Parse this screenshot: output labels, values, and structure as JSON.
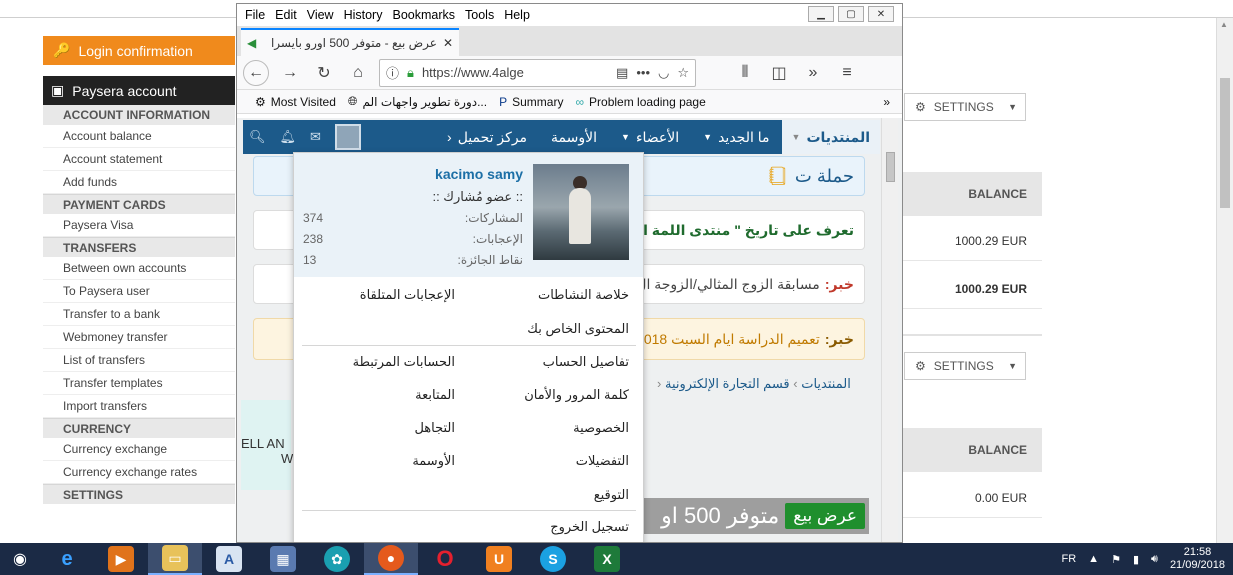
{
  "paysera": {
    "login_btn": "Login confirmation",
    "account_head": "Paysera account",
    "sections": [
      {
        "title": "ACCOUNT INFORMATION",
        "links": [
          "Account balance",
          "Account statement",
          "Add funds"
        ]
      },
      {
        "title": "PAYMENT CARDS",
        "links": [
          "Paysera Visa"
        ]
      },
      {
        "title": "TRANSFERS",
        "links": [
          "Between own accounts",
          "To Paysera user",
          "Transfer to a bank",
          "Webmoney transfer",
          "List of transfers",
          "Transfer templates",
          "Import transfers"
        ]
      },
      {
        "title": "CURRENCY",
        "links": [
          "Currency exchange",
          "Currency exchange rates"
        ]
      },
      {
        "title": "SETTINGS",
        "links": []
      }
    ],
    "settings_label": "SETTINGS",
    "balance_label": "BALANCE",
    "balances": [
      "1000.29 EUR",
      "1000.29 EUR",
      "0.00 EUR"
    ]
  },
  "firefox": {
    "menus": [
      "File",
      "Edit",
      "View",
      "History",
      "Bookmarks",
      "Tools",
      "Help"
    ],
    "tab_title": "عرض بيع - متوفر 500 اورو بايسرا",
    "url": "https://www.4alge",
    "bookmarks": [
      "Most Visited",
      "دورة تطوير واجهات الم...",
      "Summary",
      "Problem loading page"
    ]
  },
  "forum": {
    "nav": [
      "المنتديات",
      "ما الجديد",
      "الأعضاء",
      "الأوسمة",
      "مركز تحميل"
    ],
    "cards": [
      {
        "text": "حملة ت"
      },
      {
        "text": "تعرف على تاريخ \" منتدى اللمة ال"
      },
      {
        "tag": "خبر:",
        "text": "مسابقة الزوج المثالي/الزوجة ال"
      },
      {
        "tag": "خبر:",
        "text": "تعميم الدراسة ايام السبت 2018"
      }
    ],
    "breadcrumb": [
      "المنتديات",
      "قسم التجارة الإلكترونية"
    ],
    "left_text": [
      "ELL AN",
      "W"
    ],
    "sale_btn": "عرض بيع",
    "sale_text": "متوفر 500 او"
  },
  "user_menu": {
    "name": "kacimo samy",
    "rank": ":: عضو مُشارك ::",
    "stats": [
      {
        "label": "المشاركات:",
        "value": "374"
      },
      {
        "label": "الإعجابات:",
        "value": "238"
      },
      {
        "label": "نقاط الجائزة:",
        "value": "13"
      }
    ],
    "items": {
      "activity": "خلاصة النشاطات",
      "likes_received": "الإعجابات المتلقاة",
      "your_content": "المحتوى الخاص بك",
      "account_details": "تفاصيل الحساب",
      "connected_accounts": "الحسابات المرتبطة",
      "password": "كلمة المرور والأمان",
      "following": "المتابعة",
      "privacy": "الخصوصية",
      "ignoring": "التجاهل",
      "preferences": "التفضيلات",
      "trophies": "الأوسمة",
      "signature": "التوقيع",
      "logout": "تسجيل الخروج"
    }
  },
  "taskbar": {
    "lang": "FR",
    "time": "21:58",
    "date": "21/09/2018"
  }
}
